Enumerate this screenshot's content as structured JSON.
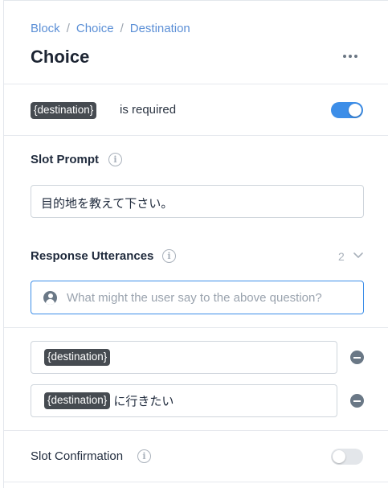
{
  "breadcrumb": [
    "Block",
    "Choice",
    "Destination"
  ],
  "breadcrumb_separator": "/",
  "title": "Choice",
  "required_row": {
    "tag": "{destination}",
    "text": "is required",
    "toggle_on": true
  },
  "slot_prompt": {
    "label": "Slot Prompt",
    "info": "i",
    "value": "目的地を教えて下さい。"
  },
  "response_utterances": {
    "label": "Response Utterances",
    "info": "i",
    "count": "2",
    "placeholder": "What might the user say to the above question?",
    "items": [
      {
        "tag": "{destination}",
        "text": ""
      },
      {
        "tag": "{destination}",
        "text": "に行きたい"
      }
    ]
  },
  "slot_confirmation": {
    "label": "Slot Confirmation",
    "info": "i",
    "toggle_on": false
  },
  "colors": {
    "accent": "#3d8ee8",
    "link": "#5b8fd6",
    "tag_bg": "#464b51"
  }
}
